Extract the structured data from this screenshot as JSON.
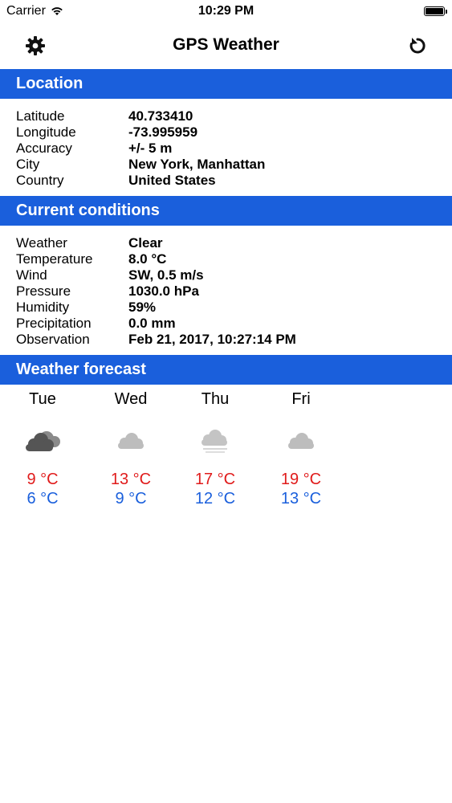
{
  "status": {
    "carrier": "Carrier",
    "time": "10:29 PM"
  },
  "nav": {
    "title": "GPS Weather",
    "left_icon": "gear-icon",
    "right_icon": "refresh-icon"
  },
  "location": {
    "header": "Location",
    "rows": [
      {
        "label": "Latitude",
        "value": "40.733410"
      },
      {
        "label": "Longitude",
        "value": "-73.995959"
      },
      {
        "label": "Accuracy",
        "value": "+/- 5 m"
      },
      {
        "label": "City",
        "value": "New York, Manhattan"
      },
      {
        "label": "Country",
        "value": "United States"
      }
    ]
  },
  "conditions": {
    "header": "Current conditions",
    "rows": [
      {
        "label": "Weather",
        "value": "Clear"
      },
      {
        "label": "Temperature",
        "value": "8.0 °C"
      },
      {
        "label": "Wind",
        "value": "SW, 0.5 m/s"
      },
      {
        "label": "Pressure",
        "value": "1030.0 hPa"
      },
      {
        "label": "Humidity",
        "value": "59%"
      },
      {
        "label": "Precipitation",
        "value": "0.0 mm"
      },
      {
        "label": "Observation",
        "value": "Feb 21, 2017, 10:27:14 PM"
      }
    ]
  },
  "forecast": {
    "header": "Weather forecast",
    "days": [
      {
        "name": "Tue",
        "high": "9 °C",
        "low": "6 °C",
        "icon": "dark-clouds-icon"
      },
      {
        "name": "Wed",
        "high": "13 °C",
        "low": "9 °C",
        "icon": "cloud-icon"
      },
      {
        "name": "Thu",
        "high": "17 °C",
        "low": "12 °C",
        "icon": "fog-cloud-icon"
      },
      {
        "name": "Fri",
        "high": "19 °C",
        "low": "13 °C",
        "icon": "cloud-icon"
      }
    ]
  },
  "colors": {
    "header_bg": "#1a5fdc",
    "high_temp": "#e01b1b",
    "low_temp": "#1a5fdc"
  }
}
